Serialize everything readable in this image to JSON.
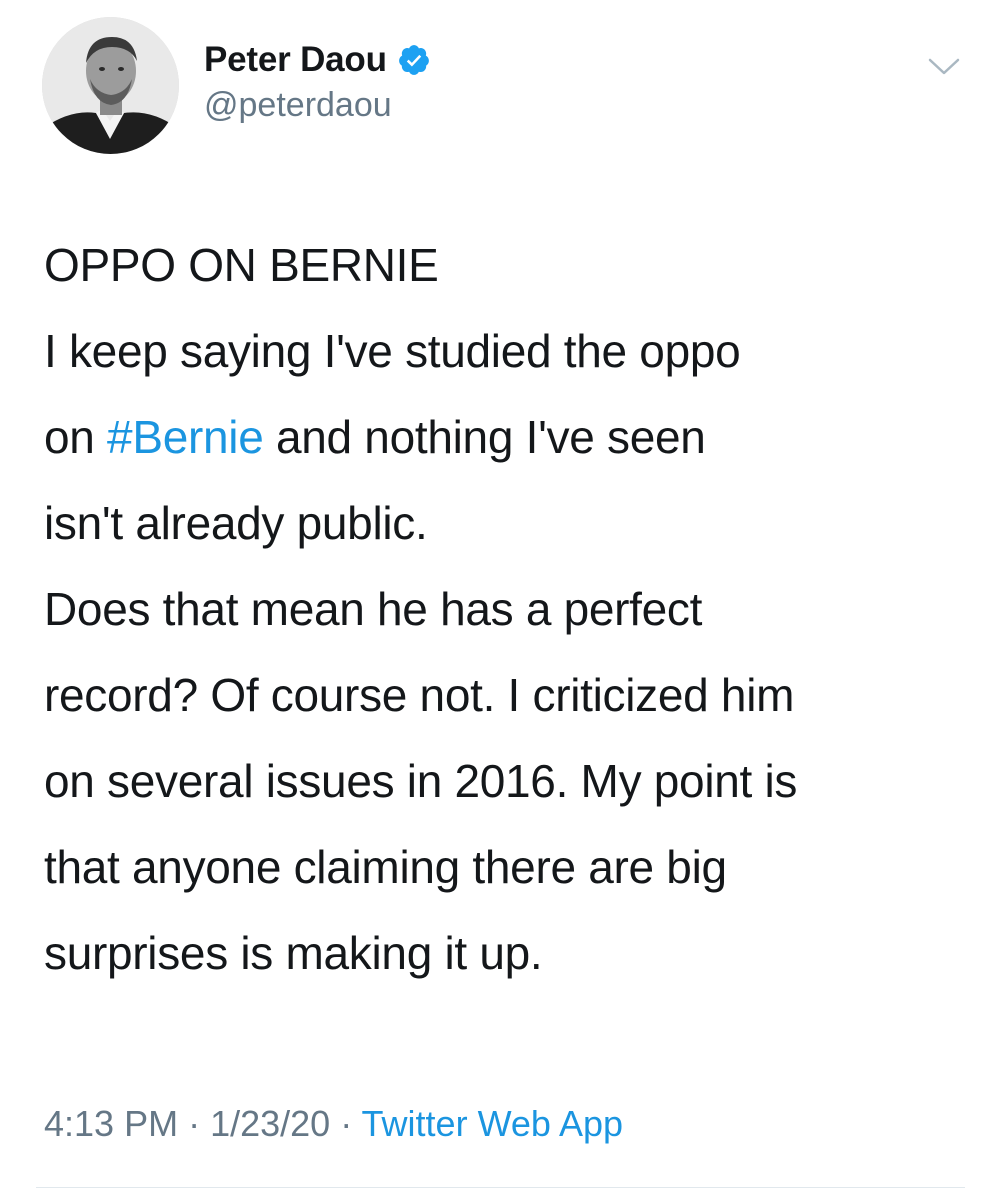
{
  "author": {
    "display_name": "Peter Daou",
    "handle": "@peterdaou",
    "verified": true
  },
  "tweet": {
    "heading": "OPPO ON BERNIE",
    "para1_line1": "I keep saying I've studied the oppo",
    "para1_line2_pre": "on ",
    "para1_hashtag": "#Bernie",
    "para1_line2_post": " and nothing I've seen",
    "para1_line3": "isn't already public.",
    "para2_line1": "Does that mean he has a perfect",
    "para2_line2": "record? Of course not. I criticized him",
    "para2_line3": "on several issues in 2016. My point is",
    "para2_line4": "that anyone claiming there are big",
    "para2_line5": "surprises is making it up."
  },
  "meta": {
    "time": "4:13 PM",
    "separator1": " · ",
    "date": "1/23/20",
    "separator2": " · ",
    "source": "Twitter Web App"
  },
  "colors": {
    "text": "#14171a",
    "secondary": "#657786",
    "link": "#1b95e0",
    "verified": "#1da1f2"
  },
  "icons": {
    "verified": "verified-badge-icon",
    "menu": "chevron-down-icon"
  }
}
